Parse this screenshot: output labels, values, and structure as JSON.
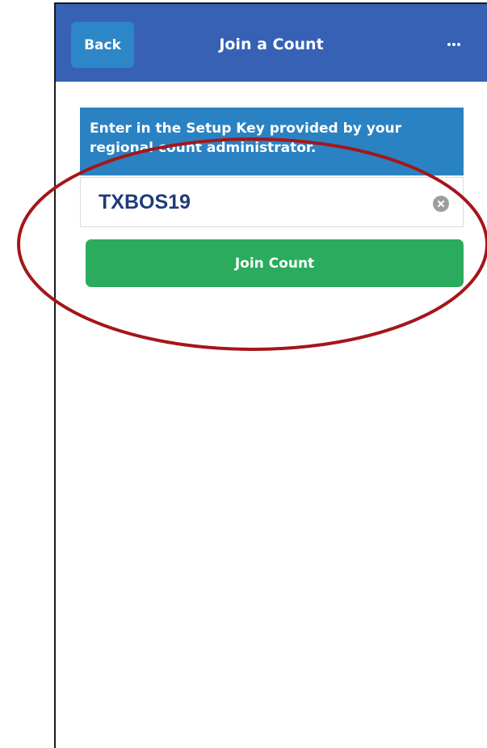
{
  "header": {
    "back_label": "Back",
    "title": "Join a Count",
    "more_icon": "ellipsis-icon"
  },
  "prompt": {
    "text": "Enter in the Setup Key provided by your regional count administrator."
  },
  "setup_key": {
    "value": "TXBOS19",
    "clear_icon": "clear-circle-icon"
  },
  "join_button": {
    "label": "Join Count"
  },
  "colors": {
    "header_bg": "#3661b5",
    "back_button_bg": "#2d86c6",
    "prompt_bg": "#2a82c3",
    "join_button_bg": "#2aab5d",
    "input_text": "#1f3b7a",
    "annotation_ellipse": "#a4161a"
  }
}
